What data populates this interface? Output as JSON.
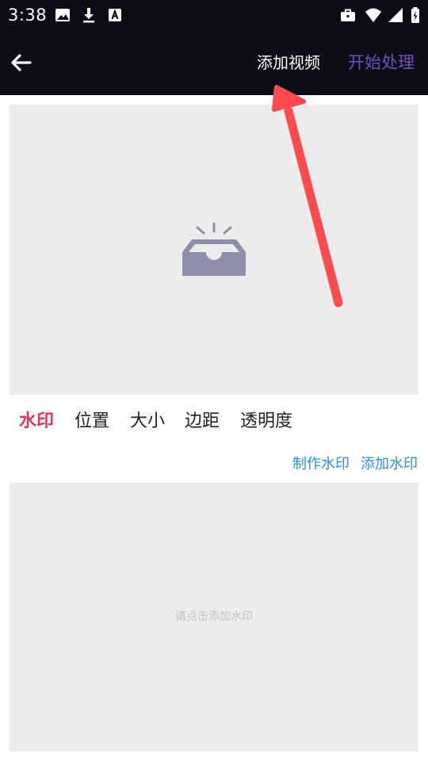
{
  "status_bar": {
    "time": "3:38",
    "left_icons": [
      "image-icon",
      "download-icon",
      "text-a-icon"
    ],
    "right_icons": [
      "briefcase-icon",
      "wifi-icon",
      "signal-icon",
      "battery-icon"
    ]
  },
  "app_bar": {
    "back_icon": "arrow-left-icon",
    "add_video_label": "添加视频",
    "start_label": "开始处理"
  },
  "video_area": {
    "icon": "empty-inbox-icon"
  },
  "tabs": [
    {
      "label": "水印",
      "active": true
    },
    {
      "label": "位置",
      "active": false
    },
    {
      "label": "大小",
      "active": false
    },
    {
      "label": "边距",
      "active": false
    },
    {
      "label": "透明度",
      "active": false
    }
  ],
  "actions": {
    "make_watermark_label": "制作水印",
    "add_watermark_label": "添加水印"
  },
  "watermark_area": {
    "placeholder": "请点击添加水印"
  },
  "colors": {
    "bar_background": "#0c0c17",
    "accent_purple": "#6e50c0",
    "tab_active": "#e0345a",
    "link_blue": "#2f8fd6",
    "panel_gray": "#ededed",
    "icon_gray": "#8e8ea8",
    "annotation_red": "#ff4b50"
  }
}
